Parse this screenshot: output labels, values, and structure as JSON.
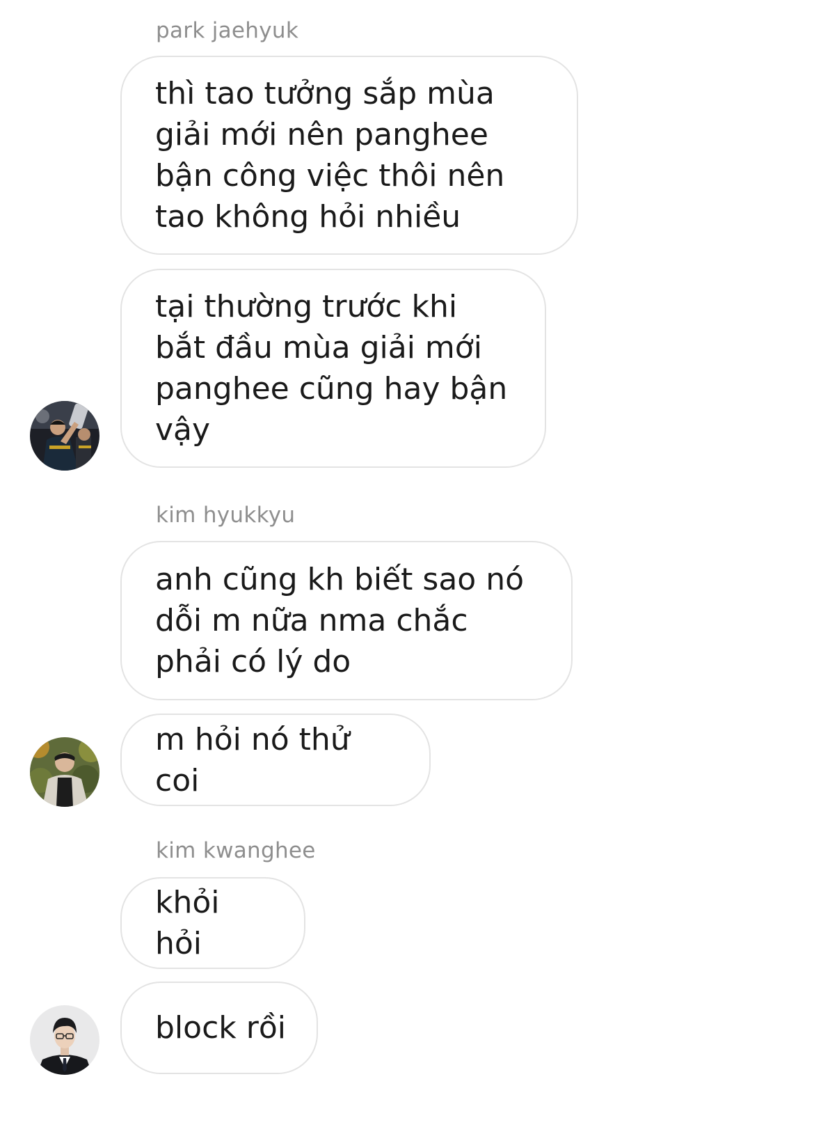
{
  "chat": {
    "groups": [
      {
        "sender": "park jaehyuk",
        "messages": [
          "thì tao tưởng sắp mùa giải mới nên panghee bận công việc thôi nên tao không hỏi nhiều",
          "tại thường trước khi bắt đầu mùa giải mới panghee cũng hay bận vậy"
        ]
      },
      {
        "sender": "kim hyukkyu",
        "messages": [
          "anh cũng kh biết sao nó dỗi m nữa nma chắc phải có lý do",
          "m hỏi nó thử coi"
        ]
      },
      {
        "sender": "kim kwanghee",
        "messages": [
          "khỏi hỏi",
          "block rồi"
        ]
      }
    ]
  },
  "avatars": {
    "park_jaehyuk": "trophy-photo-avatar",
    "kim_hyukkyu": "outdoor-photo-avatar",
    "kim_kwanghee": "suit-portrait-avatar"
  },
  "colors": {
    "background": "#ffffff",
    "bubble_border": "#e3e3e3",
    "text": "#1a1a1a",
    "sender_name": "#8e8e8e"
  }
}
